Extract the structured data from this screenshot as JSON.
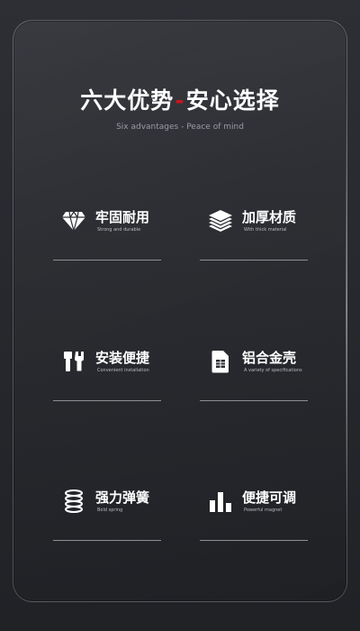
{
  "header": {
    "title_left": "六大优势",
    "title_sep": "-",
    "title_right": "安心选择",
    "subtitle": "Six advantages - Peace of mind"
  },
  "features": [
    {
      "label": "牢固耐用",
      "desc": "Strong and durable",
      "icon": "diamond-icon"
    },
    {
      "label": "加厚材质",
      "desc": "With thick material",
      "icon": "layers-icon"
    },
    {
      "label": "安装便捷",
      "desc": "Convenient installation",
      "icon": "wrench-icon"
    },
    {
      "label": "铝合金壳",
      "desc": "A variety of specifications",
      "icon": "sim-card-icon"
    },
    {
      "label": "强力弹簧",
      "desc": "Bold spring",
      "icon": "spring-icon"
    },
    {
      "label": "便捷可调",
      "desc": "Powerful magnet",
      "icon": "bar-chart-icon"
    }
  ],
  "colors": {
    "accent": "#c4171d",
    "background": "#2b2d33",
    "text": "#ffffff"
  }
}
